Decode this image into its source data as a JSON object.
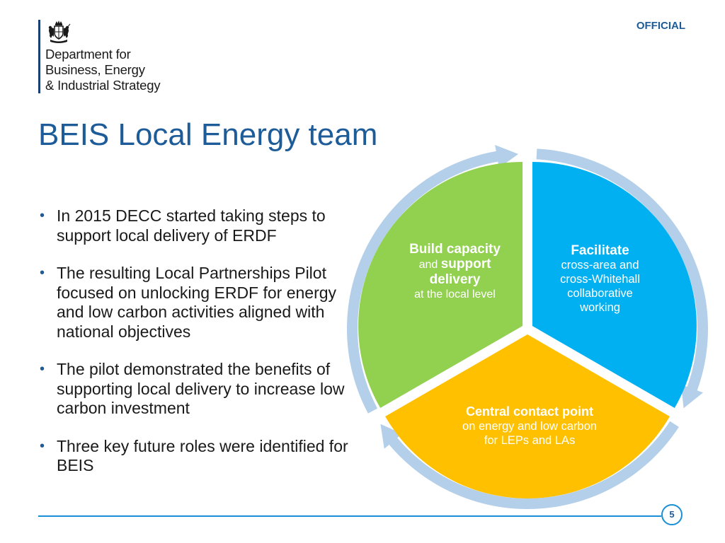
{
  "header": {
    "classification": "OFFICIAL",
    "department": {
      "line1": "Department for",
      "line2": "Business, Energy",
      "line3": "& Industrial Strategy"
    },
    "crest_icon": "royal-coat-of-arms-icon"
  },
  "title": "BEIS Local Energy team",
  "bullets": [
    "In 2015 DECC started taking steps to support local delivery of ERDF",
    "The resulting Local Partnerships Pilot focused on unlocking ERDF for energy and low carbon activities aligned with national objectives",
    "The pilot demonstrated the benefits of supporting local delivery to increase low carbon investment",
    "Three key future roles were identified for BEIS"
  ],
  "diagram": {
    "colors": {
      "green": "#92d050",
      "blue": "#00b0f0",
      "yellow": "#ffc000",
      "arrow": "#b4cfe9"
    },
    "green": {
      "bold1": "Build capacity",
      "plain1": "and",
      "bold2": "support",
      "bold3": "delivery",
      "plain2": "at the local level"
    },
    "blue": {
      "bold": "Facilitate",
      "line1": "cross-area and",
      "line2": "cross-Whitehall",
      "line3": "collaborative",
      "line4": "working"
    },
    "yellow": {
      "bold": "Central contact point",
      "line1": "on energy and low carbon",
      "line2": "for LEPs and LAs"
    }
  },
  "footer": {
    "page_number": "5"
  }
}
